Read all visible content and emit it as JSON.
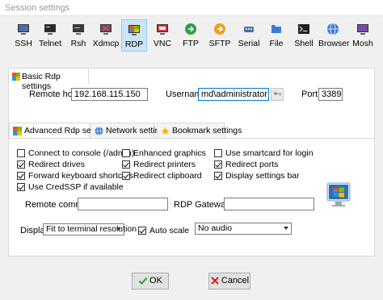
{
  "window": {
    "title": "Session settings"
  },
  "protocols": [
    {
      "label": "SSH",
      "icon": "ssh-icon"
    },
    {
      "label": "Telnet",
      "icon": "telnet-icon"
    },
    {
      "label": "Rsh",
      "icon": "rsh-icon"
    },
    {
      "label": "Xdmcp",
      "icon": "xdmcp-icon"
    },
    {
      "label": "RDP",
      "icon": "rdp-icon",
      "active": true
    },
    {
      "label": "VNC",
      "icon": "vnc-icon"
    },
    {
      "label": "FTP",
      "icon": "ftp-icon"
    },
    {
      "label": "SFTP",
      "icon": "sftp-icon"
    },
    {
      "label": "Serial",
      "icon": "serial-icon"
    },
    {
      "label": "File",
      "icon": "file-icon"
    },
    {
      "label": "Shell",
      "icon": "shell-icon"
    },
    {
      "label": "Browser",
      "icon": "browser-icon"
    },
    {
      "label": "Mosh",
      "icon": "mosh-icon"
    }
  ],
  "basic": {
    "tab_label": "Basic Rdp settings",
    "remote_host_label": "Remote host *",
    "remote_host_value": "192.168.115.150",
    "username_label": "Username",
    "username_value": "md\\administrator",
    "port_label": "Port",
    "port_value": "3389"
  },
  "advanced_tabs": [
    {
      "label": "Advanced Rdp settings",
      "active": true
    },
    {
      "label": "Network settings"
    },
    {
      "label": "Bookmark settings"
    }
  ],
  "options": {
    "connect_console": {
      "label": "Connect to console (/admin)",
      "checked": false
    },
    "enhanced_graphics": {
      "label": "Enhanced graphics",
      "checked": false
    },
    "smartcard": {
      "label": "Use smartcard for login",
      "checked": false
    },
    "redirect_drives": {
      "label": "Redirect drives",
      "checked": true
    },
    "redirect_printers": {
      "label": "Redirect printers",
      "checked": true
    },
    "redirect_ports": {
      "label": "Redirect ports",
      "checked": true
    },
    "forward_shortcuts": {
      "label": "Forward keyboard shortcuts",
      "checked": true
    },
    "redirect_clipboard": {
      "label": "Redirect clipboard",
      "checked": true
    },
    "display_bar": {
      "label": "Display settings bar",
      "checked": true
    },
    "credssp": {
      "label": "Use CredSSP if available",
      "checked": true
    },
    "auto_scale": {
      "label": "Auto scale",
      "checked": true
    }
  },
  "fields": {
    "remote_command_label": "Remote command",
    "remote_command_value": "",
    "rdp_gateway_label": "RDP Gateway",
    "rdp_gateway_value": "",
    "display_label": "Display",
    "display_value": "Fit to terminal resolution",
    "audio_value": "No audio"
  },
  "buttons": {
    "ok": "OK",
    "cancel": "Cancel"
  },
  "colors": {
    "accent": "#0078d7",
    "active_tab_bg": "#cce4f7",
    "ok_icon": "#2e9e2e",
    "cancel_icon": "#d02020"
  }
}
